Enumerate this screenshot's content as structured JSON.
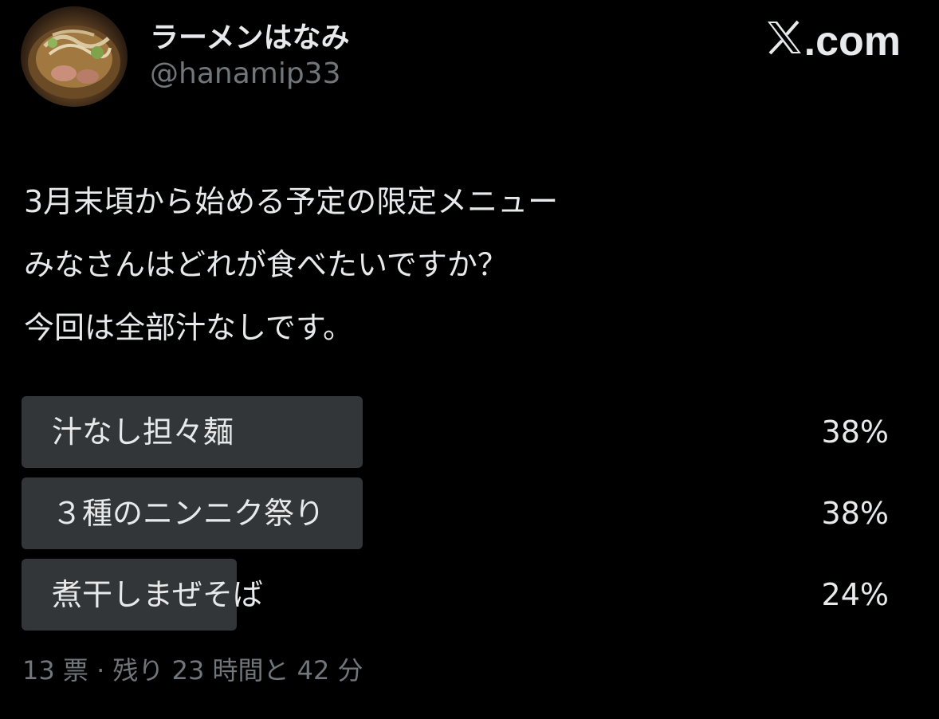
{
  "author": {
    "display_name": "ラーメンはなみ",
    "handle": "@hanamip33"
  },
  "brand": {
    "logo_icon": "x-logo-icon",
    "suffix": ".com"
  },
  "post": {
    "lines": [
      "3月末頃から始める予定の限定メニュー",
      "みなさんはどれが食べたいですか？",
      "今回は全部汁なしです。"
    ]
  },
  "poll": {
    "options": [
      {
        "label": "汁なし担々麺",
        "percent_text": "38%",
        "fraction": 0.38
      },
      {
        "label": "３種のニンニク祭り",
        "percent_text": "38%",
        "fraction": 0.38
      },
      {
        "label": "煮干しまぜそば",
        "percent_text": "24%",
        "fraction": 0.24
      }
    ],
    "footer": "13 票 · 残り 23 時間と 42 分"
  },
  "colors": {
    "background": "#000000",
    "text_primary": "#e7e9ea",
    "text_secondary": "#71767b",
    "poll_bar": "#333639"
  }
}
